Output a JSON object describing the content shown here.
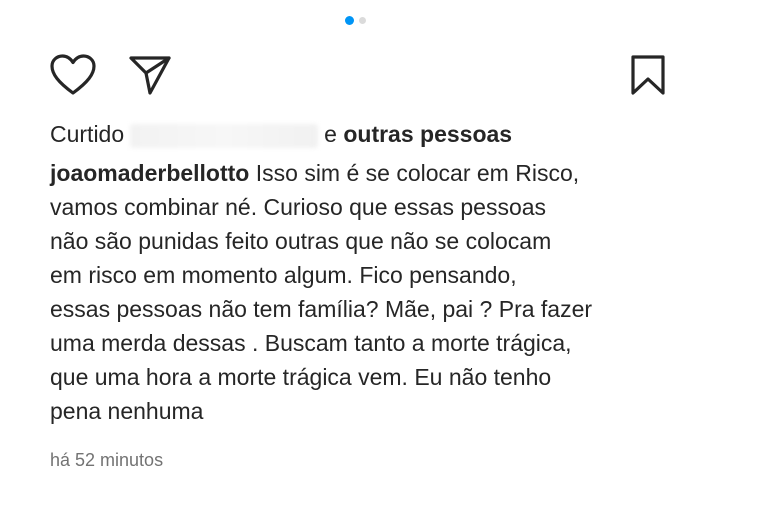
{
  "carousel": {
    "total": 2,
    "active_index": 0
  },
  "actions": {
    "like_icon": "heart-outline-icon",
    "share_icon": "paper-plane-icon",
    "save_icon": "bookmark-outline-icon"
  },
  "likes": {
    "prefix": "Curtido",
    "suffix_plain": "e",
    "suffix_bold": "outras pessoas"
  },
  "comment": {
    "username": "joaomaderbellotto",
    "lines": [
      "Isso sim é se colocar em Risco,",
      "vamos combinar né. Curioso que essas pessoas",
      "não são punidas feito outras que não se colocam",
      "em risco em momento algum.  Fico pensando,",
      "essas pessoas não tem família? Mãe, pai ? Pra fazer",
      "uma merda dessas . Buscam tanto a morte trágica,",
      "que uma hora a morte trágica vem. Eu não tenho",
      "pena nenhuma"
    ]
  },
  "timestamp": "há 52 minutos",
  "colors": {
    "accent": "#0095f6",
    "text": "#262626",
    "muted": "#737373"
  }
}
